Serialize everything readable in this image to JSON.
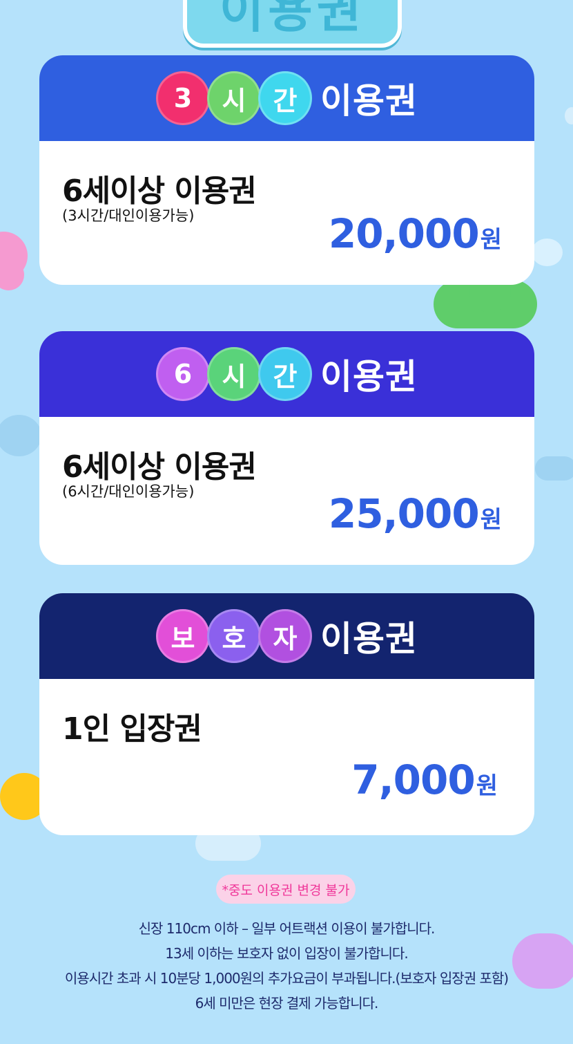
{
  "header": {
    "title_partial": "이용권"
  },
  "cards": [
    {
      "badge": [
        "3",
        "시",
        "간"
      ],
      "badge_label": "이용권",
      "name": "6세이상 이용권",
      "note": "(3시간/대인이용가능)",
      "price": "20,000",
      "unit": "원",
      "colors": {
        "head": "#2f5fe0",
        "bubbles": [
          "#f22f6e",
          "#6ed36b",
          "#3fd7ee"
        ]
      }
    },
    {
      "badge": [
        "6",
        "시",
        "간"
      ],
      "badge_label": "이용권",
      "name": "6세이상 이용권",
      "note": "(6시간/대인이용가능)",
      "price": "25,000",
      "unit": "원",
      "colors": {
        "head": "#3a30d8",
        "bubbles": [
          "#c05ff0",
          "#5ad37a",
          "#3fc9ee"
        ]
      }
    },
    {
      "badge": [
        "보",
        "호",
        "자"
      ],
      "badge_label": "이용권",
      "name": "1인 입장권",
      "note": "",
      "price": "7,000",
      "unit": "원",
      "colors": {
        "head": "#13246f",
        "bubbles": [
          "#e24fd8",
          "#8b60ee",
          "#b150e0"
        ]
      }
    }
  ],
  "notice": {
    "pill": "*중도 이용권 변경 불가",
    "lines": [
      "신장 110cm 이하 – 일부 어트랙션 이용이 불가합니다.",
      "13세 이하는 보호자 없이 입장이 불가합니다.",
      "이용시간 초과 시 10분당 1,000원의 추가요금이 부과됩니다.(보호자 입장권 포함)",
      "6세 미만은 현장 결제 가능합니다."
    ]
  },
  "colors": {
    "background": "#b5e2fb",
    "price": "#2f5fe0",
    "pill_bg": "#fbd2e8",
    "pill_text": "#f0389a"
  }
}
